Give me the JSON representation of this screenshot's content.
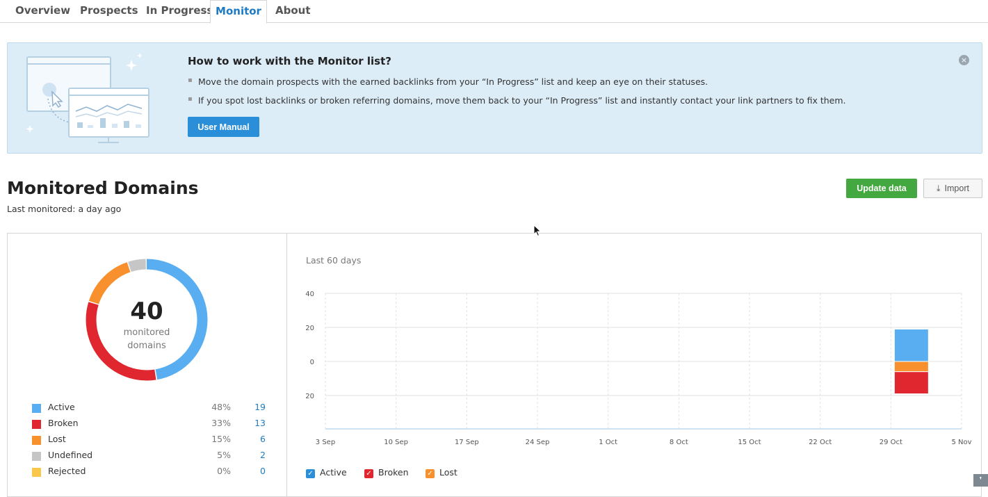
{
  "tabs": [
    "Overview",
    "Prospects",
    "In Progress",
    "Monitor",
    "About"
  ],
  "active_tab": "Monitor",
  "banner": {
    "title": "How to work with the Monitor list?",
    "bullets": [
      "Move the domain prospects with the earned backlinks from your “In Progress” list and keep an eye on their statuses.",
      "If you spot lost backlinks or broken referring domains, move them back to your “In Progress” list and instantly contact your link partners to fix them."
    ],
    "button_label": "User Manual"
  },
  "header": {
    "title": "Monitored Domains",
    "subtitle": "Last monitored: a day ago",
    "update_label": "Update data",
    "import_label": "Import"
  },
  "summary": {
    "total": "40",
    "total_label_line1": "monitored",
    "total_label_line2": "domains",
    "legend": [
      {
        "name": "Active",
        "percent": "48%",
        "count": "19",
        "color": "#58aef0"
      },
      {
        "name": "Broken",
        "percent": "33%",
        "count": "13",
        "color": "#e0272f"
      },
      {
        "name": "Lost",
        "percent": "15%",
        "count": "6",
        "color": "#f7902d"
      },
      {
        "name": "Undefined",
        "percent": "5%",
        "count": "2",
        "color": "#c6c6c6"
      },
      {
        "name": "Rejected",
        "percent": "0%",
        "count": "0",
        "color": "#f9c84a"
      }
    ]
  },
  "chart": {
    "period_label": "Last 60 days",
    "toggles": [
      {
        "name": "Active",
        "color": "#2b8ed8"
      },
      {
        "name": "Broken",
        "color": "#e0272f"
      },
      {
        "name": "Lost",
        "color": "#f7902d"
      }
    ]
  },
  "chart_data": {
    "type": "bar",
    "categories": [
      "3 Sep",
      "10 Sep",
      "17 Sep",
      "24 Sep",
      "1 Oct",
      "8 Oct",
      "15 Oct",
      "22 Oct",
      "29 Oct",
      "5 Nov"
    ],
    "y_tick_labels": [
      "40",
      "20",
      "0",
      "20"
    ],
    "ylim": [
      -40,
      40
    ],
    "series": [
      {
        "name": "Active",
        "color": "#58aef0",
        "x": "29 Oct",
        "values_positive": 19
      },
      {
        "name": "Lost",
        "color": "#f7902d",
        "x": "29 Oct",
        "values_negative": -6
      },
      {
        "name": "Broken",
        "color": "#e0272f",
        "x": "29 Oct",
        "values_negative": -13
      }
    ],
    "grid": true
  }
}
